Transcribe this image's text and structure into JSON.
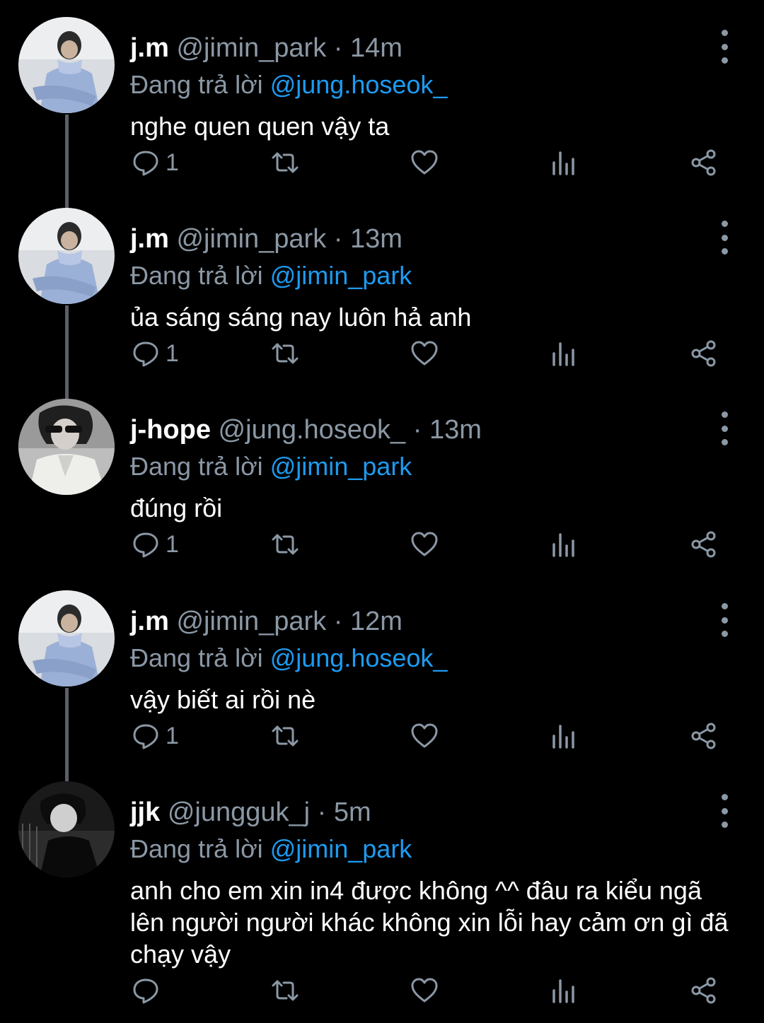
{
  "tweets": [
    {
      "name": "j.m",
      "handle": "@jimin_park",
      "dot": "·",
      "time": "14m",
      "replying_prefix": "Đang trả lời",
      "replying_to": "@jung.hoseok_",
      "text": "nghe quen quen vậy ta",
      "reply_count": "1",
      "avatar": "avatar-jm"
    },
    {
      "name": "j.m",
      "handle": "@jimin_park",
      "dot": "·",
      "time": "13m",
      "replying_prefix": "Đang trả lời",
      "replying_to": "@jimin_park",
      "text": "ủa sáng sáng nay luôn hả anh",
      "reply_count": "1",
      "avatar": "avatar-jm"
    },
    {
      "name": "j-hope",
      "handle": "@jung.hoseok_",
      "dot": "·",
      "time": "13m",
      "replying_prefix": "Đang trả lời",
      "replying_to": "@jimin_park",
      "text": "đúng rồi",
      "reply_count": "1",
      "avatar": "avatar-jhope"
    },
    {
      "name": "j.m",
      "handle": "@jimin_park",
      "dot": "·",
      "time": "12m",
      "replying_prefix": "Đang trả lời",
      "replying_to": "@jung.hoseok_",
      "text": "vậy biết ai rồi nè",
      "reply_count": "1",
      "avatar": "avatar-jm"
    },
    {
      "name": "jjk",
      "handle": "@jungguk_j",
      "dot": "·",
      "time": "5m",
      "replying_prefix": "Đang trả lời",
      "replying_to": "@jimin_park",
      "text": "anh cho em xin in4 được không ^^ đâu ra kiểu ngã lên người người khác không xin lỗi hay cảm ơn gì đã chạy vậy",
      "reply_count": "",
      "avatar": "avatar-jjk"
    }
  ],
  "icons": {
    "reply": "reply-icon",
    "retweet": "retweet-icon",
    "like": "heart-icon",
    "analytics": "analytics-icon",
    "share": "share-icon",
    "more": "more-vertical-icon"
  },
  "colors": {
    "background": "#000000",
    "text": "#ffffff",
    "muted": "#8b98a5",
    "mention": "#1d9bf0",
    "thread_line": "#5c6066"
  }
}
